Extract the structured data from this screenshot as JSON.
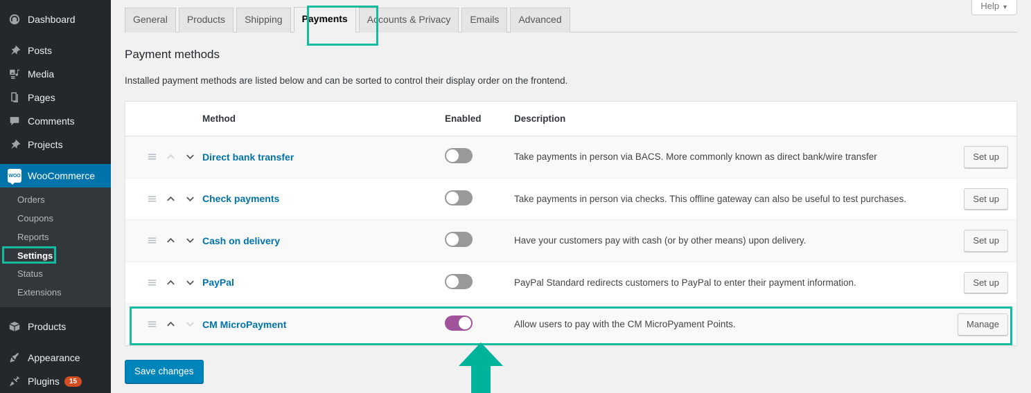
{
  "sidebar": {
    "items": [
      {
        "label": "Dashboard",
        "icon": "dashboard-icon"
      },
      {
        "label": "Posts",
        "icon": "pin-icon"
      },
      {
        "label": "Media",
        "icon": "media-icon"
      },
      {
        "label": "Pages",
        "icon": "pages-icon"
      },
      {
        "label": "Comments",
        "icon": "comments-icon"
      },
      {
        "label": "Projects",
        "icon": "pin-icon"
      }
    ],
    "woocommerce": {
      "label": "WooCommerce",
      "icon": "woo-icon",
      "badge": "woo"
    },
    "submenu": [
      {
        "label": "Orders",
        "active": false
      },
      {
        "label": "Coupons",
        "active": false
      },
      {
        "label": "Reports",
        "active": false
      },
      {
        "label": "Settings",
        "active": true
      },
      {
        "label": "Status",
        "active": false
      },
      {
        "label": "Extensions",
        "active": false
      }
    ],
    "bottom_items": [
      {
        "label": "Products",
        "icon": "box-icon",
        "count": ""
      },
      {
        "label": "Appearance",
        "icon": "brush-icon",
        "count": ""
      },
      {
        "label": "Plugins",
        "icon": "plug-icon",
        "count": "15"
      }
    ]
  },
  "header": {
    "help_label": "Help",
    "help_caret": "▼"
  },
  "tabs": [
    {
      "label": "General",
      "active": false
    },
    {
      "label": "Products",
      "active": false
    },
    {
      "label": "Shipping",
      "active": false
    },
    {
      "label": "Payments",
      "active": true
    },
    {
      "label": "Accounts & Privacy",
      "active": false
    },
    {
      "label": "Emails",
      "active": false
    },
    {
      "label": "Advanced",
      "active": false
    }
  ],
  "main": {
    "title": "Payment methods",
    "description": "Installed payment methods are listed below and can be sorted to control their display order on the frontend.",
    "save_label": "Save changes"
  },
  "table": {
    "columns": [
      "",
      "Method",
      "Enabled",
      "Description",
      ""
    ],
    "rows": [
      {
        "method": "Direct bank transfer",
        "enabled": false,
        "description": "Take payments in person via BACS. More commonly known as direct bank/wire transfer",
        "action": "Set up",
        "up_disabled": true,
        "down_disabled": false
      },
      {
        "method": "Check payments",
        "enabled": false,
        "description": "Take payments in person via checks. This offline gateway can also be useful to test purchases.",
        "action": "Set up",
        "up_disabled": false,
        "down_disabled": false
      },
      {
        "method": "Cash on delivery",
        "enabled": false,
        "description": "Have your customers pay with cash (or by other means) upon delivery.",
        "action": "Set up",
        "up_disabled": false,
        "down_disabled": false
      },
      {
        "method": "PayPal",
        "enabled": false,
        "description": "PayPal Standard redirects customers to PayPal to enter their payment information.",
        "action": "Set up",
        "up_disabled": false,
        "down_disabled": false
      },
      {
        "method": "CM MicroPayment",
        "enabled": true,
        "description": "Allow users to pay with the CM MicroPyament Points.",
        "action": "Manage",
        "up_disabled": false,
        "down_disabled": true
      }
    ]
  },
  "colors": {
    "highlight": "#13bc9c",
    "accent_blue": "#0073aa",
    "toggle_on": "#a0539a",
    "badge_red": "#d54e21"
  }
}
